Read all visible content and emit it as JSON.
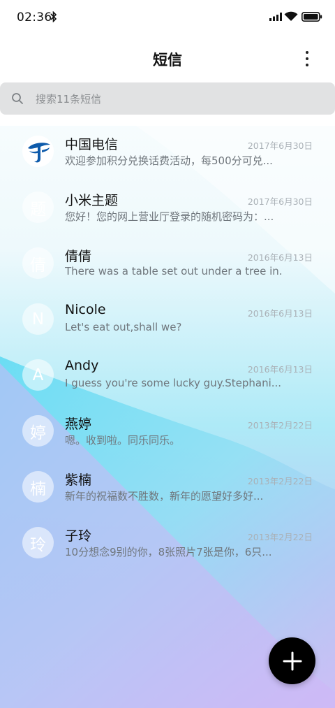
{
  "status_bar": {
    "time": "02:36",
    "icons": [
      "bluetooth-icon",
      "signal-icon",
      "wifi-icon",
      "battery-icon"
    ]
  },
  "header": {
    "title": "短信",
    "menu_icon": "more-vertical-icon"
  },
  "search": {
    "placeholder": "搜索11条短信",
    "icon": "search-icon"
  },
  "conversations": [
    {
      "name": "中国电信",
      "date": "2017年6月30日",
      "preview": "欢迎参加积分兑换话费活动，每500分可兑...",
      "avatar": "china-telecom-logo"
    },
    {
      "name": "小米主题",
      "date": "2017年6月30日",
      "preview": "您好！您的网上营业厅登录的随机密码为：...",
      "avatar": "题"
    },
    {
      "name": "倩倩",
      "date": "2016年6月13日",
      "preview": "There was a table set out under a tree in...",
      "avatar": "倩"
    },
    {
      "name": "Nicole",
      "date": "2016年6月13日",
      "preview": "Let's eat out,shall we?",
      "avatar": "N"
    },
    {
      "name": "Andy",
      "date": "2016年6月13日",
      "preview": "I guess you're some lucky guy.Stephani...",
      "avatar": "A"
    },
    {
      "name": "燕婷",
      "date": "2013年2月22日",
      "preview": "嗯。收到啦。同乐同乐。",
      "avatar": "婷"
    },
    {
      "name": "紫楠",
      "date": "2013年2月22日",
      "preview": "新年的祝福数不胜数，新年的愿望好多好...",
      "avatar": "楠"
    },
    {
      "name": "子玲",
      "date": "2013年2月22日",
      "preview": "10分想念9别的你，8张照片7张是你，6只...",
      "avatar": "玲"
    }
  ],
  "fab": {
    "icon": "plus-icon"
  },
  "colors": {
    "accent_cyan": "#5fd8f2",
    "accent_purple": "#d4b8f5",
    "fab": "#000000",
    "search_bg": "#e1e2e3"
  }
}
